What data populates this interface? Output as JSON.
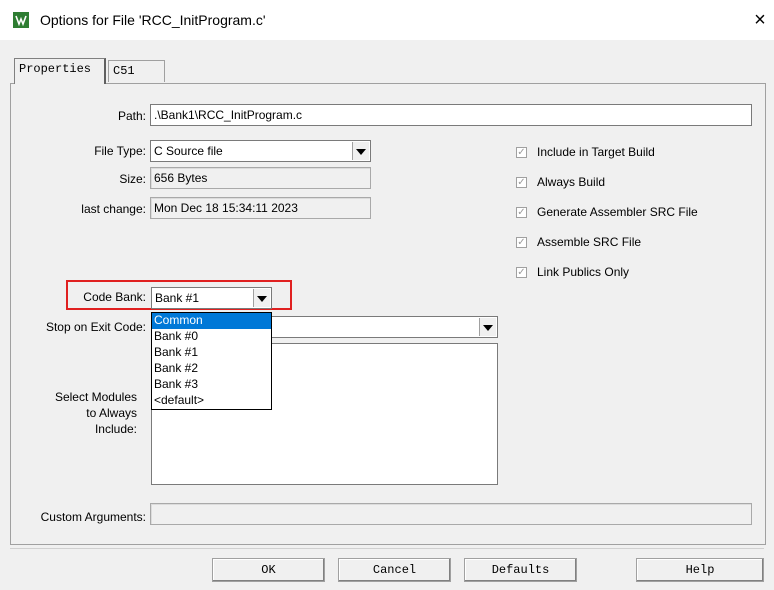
{
  "window": {
    "title": "Options for File 'RCC_InitProgram.c'",
    "close_glyph": "×",
    "icon": "uvision-app-icon"
  },
  "tabs": [
    {
      "label": "Properties",
      "active": true
    },
    {
      "label": "C51",
      "active": false
    }
  ],
  "properties": {
    "path_label": "Path:",
    "path_value": ".\\Bank1\\RCC_InitProgram.c",
    "file_type_label": "File Type:",
    "file_type_value": "C Source file",
    "size_label": "Size:",
    "size_value": "656 Bytes",
    "last_change_label": "last change:",
    "last_change_value": "Mon Dec 18 15:34:11 2023",
    "code_bank_label": "Code Bank:",
    "code_bank_value": "Bank #1",
    "stop_on_exit_label": "Stop on Exit Code:",
    "select_modules_label_1": "Select Modules",
    "select_modules_label_2": "to Always",
    "select_modules_label_3": "Include:",
    "custom_args_label": "Custom Arguments:",
    "custom_args_value": ""
  },
  "checkboxes": [
    {
      "label": "Include in Target Build",
      "checked": true
    },
    {
      "label": "Always Build",
      "checked": true
    },
    {
      "label": "Generate Assembler SRC File",
      "checked": true
    },
    {
      "label": "Assemble SRC File",
      "checked": true
    },
    {
      "label": "Link Publics Only",
      "checked": true
    }
  ],
  "code_bank_dropdown": {
    "options": [
      "Common",
      "Bank #0",
      "Bank #1",
      "Bank #2",
      "Bank #3",
      "<default>"
    ],
    "highlighted": "Common"
  },
  "buttons": {
    "ok": "OK",
    "cancel": "Cancel",
    "defaults": "Defaults",
    "help": "Help"
  },
  "colors": {
    "highlight_box": "#e02020",
    "selection": "#0078d7"
  }
}
